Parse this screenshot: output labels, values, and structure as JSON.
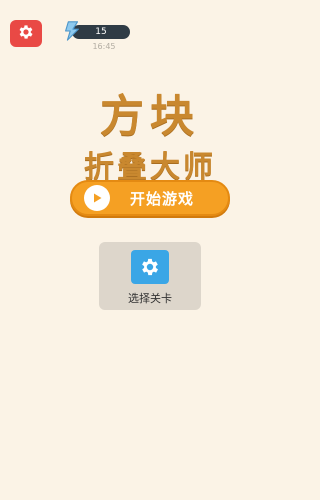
{
  "header": {
    "settings_icon": "gear-icon",
    "energy_icon": "lightning-icon",
    "energy_value": "15",
    "timer": "16:45"
  },
  "title": {
    "line1": "方块",
    "line2": "折叠大师"
  },
  "start_button": {
    "icon": "play-icon",
    "label": "开始游戏"
  },
  "level_select": {
    "icon": "gear-icon",
    "label": "选择关卡"
  },
  "colors": {
    "background": "#fbf3e6",
    "title": "#c9882f",
    "start_button": "#f5a023",
    "settings_button": "#e94945",
    "level_icon_bg": "#3aa6e6"
  }
}
